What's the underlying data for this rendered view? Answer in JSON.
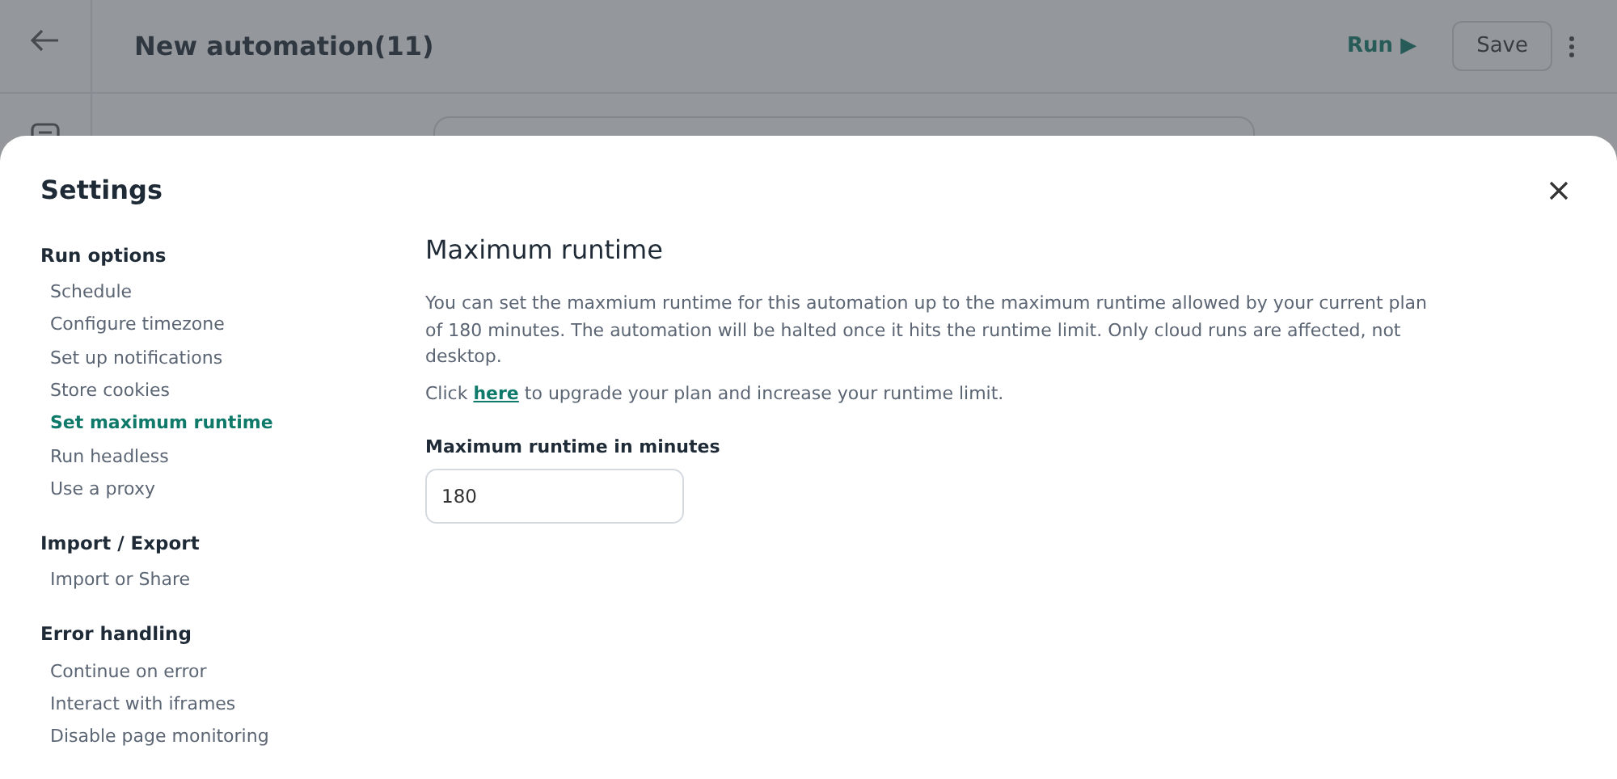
{
  "app_bar": {
    "title": "New automation(11)",
    "run_label": "Run ▶",
    "save_label": "Save"
  },
  "settings": {
    "title": "Settings",
    "sections": [
      {
        "heading": "Run options",
        "items": [
          {
            "label": "Schedule",
            "selected": false
          },
          {
            "label": "Configure timezone",
            "selected": false
          },
          {
            "label": "Set up notifications",
            "selected": false
          },
          {
            "label": "Store cookies",
            "selected": false
          },
          {
            "label": "Set maximum runtime",
            "selected": true
          },
          {
            "label": "Run headless",
            "selected": false
          },
          {
            "label": "Use a proxy",
            "selected": false
          }
        ]
      },
      {
        "heading": "Import / Export",
        "items": [
          {
            "label": "Import or Share",
            "selected": false
          }
        ]
      },
      {
        "heading": "Error handling",
        "items": [
          {
            "label": "Continue on error",
            "selected": false
          },
          {
            "label": "Interact with iframes",
            "selected": false
          },
          {
            "label": "Disable page monitoring",
            "selected": false
          }
        ]
      }
    ],
    "panel": {
      "heading": "Maximum runtime",
      "description": "You can set the maxmium runtime for this automation up to the maximum runtime allowed by your current plan of 180 minutes. The automation will be halted once it hits the runtime limit. Only cloud runs are affected, not desktop.",
      "upgrade_note": {
        "before": "Click ",
        "link": "here",
        "after": " to upgrade your plan and increase your runtime limit."
      },
      "field_label": "Maximum runtime in minutes",
      "field_value": "180"
    }
  }
}
